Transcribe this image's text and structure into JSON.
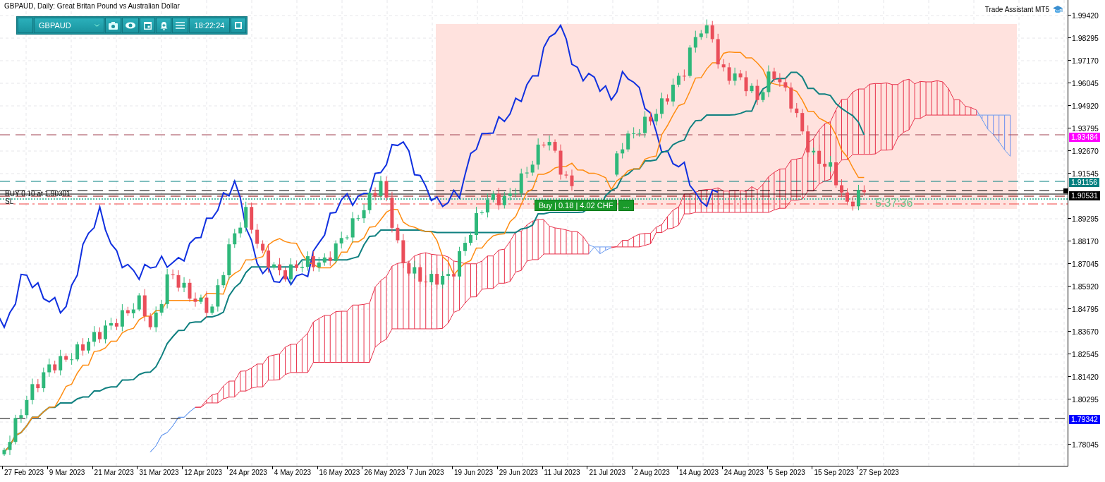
{
  "chart": {
    "title": "GBPAUD, Daily:  Great Britan Pound vs Australian Dollar",
    "assistant_label": "Trade Assistant MT5",
    "position_label": "BUY 0.10 at 1.90301",
    "stop_label": "SL",
    "buy_button": "Buy | 0.18 | 4.02 CHF",
    "more_button": "...",
    "countdown": "5:37:36"
  },
  "toolbar": {
    "symbol": "GBPAUD",
    "clock": "18:22:24"
  },
  "price_axis": {
    "ticks": [
      "1.99420",
      "1.98295",
      "1.97170",
      "1.96045",
      "1.94920",
      "1.93795",
      "1.92670",
      "1.91545",
      "1.89295",
      "1.88170",
      "1.87045",
      "1.85920",
      "1.84795",
      "1.83670",
      "1.82545",
      "1.81420",
      "1.80295",
      "1.78045"
    ],
    "markers": [
      {
        "value": "1.93484",
        "color": "#ff00ff"
      },
      {
        "value": "1.91156",
        "color": "#008080"
      },
      {
        "value": "1.90531",
        "color": "#000000"
      },
      {
        "value": "1.79342",
        "color": "#0000ff"
      }
    ]
  },
  "time_axis": {
    "ticks": [
      "27 Feb 2023",
      "9 Mar 2023",
      "21 Mar 2023",
      "31 Mar 2023",
      "12 Apr 2023",
      "24 Apr 2023",
      "4 May 2023",
      "16 May 2023",
      "26 May 2023",
      "7 Jun 2023",
      "19 Jun 2023",
      "29 Jun 2023",
      "11 Jul 2023",
      "21 Jul 2023",
      "2 Aug 2023",
      "14 Aug 2023",
      "24 Aug 2023",
      "5 Sep 2023",
      "15 Sep 2023",
      "27 Sep 2023"
    ]
  }
}
